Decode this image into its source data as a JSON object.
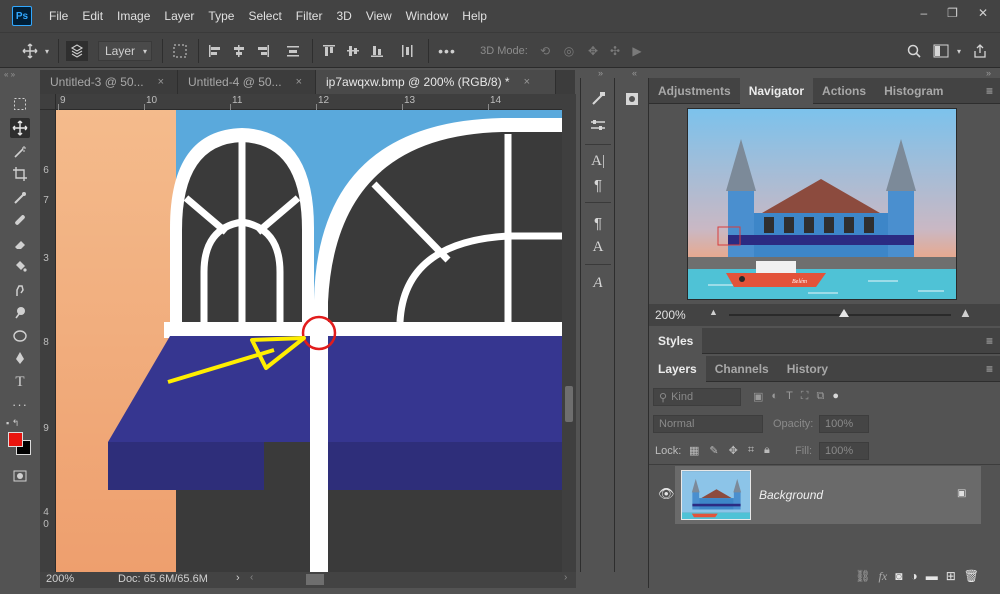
{
  "app": {
    "logo": "Ps"
  },
  "menu": [
    "File",
    "Edit",
    "Image",
    "Layer",
    "Type",
    "Select",
    "Filter",
    "3D",
    "View",
    "Window",
    "Help"
  ],
  "window_controls": {
    "minimize": "–",
    "restore": "❐",
    "close": "✕"
  },
  "options_bar": {
    "auto_select_target": "Layer",
    "mode_3d_label": "3D Mode:"
  },
  "document_tabs": [
    {
      "label": "Untitled-3 @ 50...",
      "close": "×"
    },
    {
      "label": "Untitled-4 @ 50...",
      "close": "×"
    },
    {
      "label": "ip7awqxw.bmp @ 200% (RGB/8) *",
      "close": "×",
      "active": true
    }
  ],
  "ruler": {
    "top": [
      "9",
      "10",
      "11",
      "12",
      "13",
      "14"
    ],
    "left": [
      "6",
      "7",
      "3",
      "8",
      "9",
      "4",
      "0"
    ]
  },
  "status": {
    "zoom": "200%",
    "doc": "Doc: 65.6M/65.6M",
    "arrow": "›"
  },
  "navigator_panel": {
    "tabs": [
      "Adjustments",
      "Navigator",
      "Actions",
      "Histogram"
    ],
    "active_tab": "Navigator",
    "zoom": "200%",
    "zoom_slider_level": 0.52,
    "boat_label": "Belém"
  },
  "styles_panel": {
    "title": "Styles"
  },
  "layers_panel": {
    "tabs": [
      "Layers",
      "Channels",
      "History"
    ],
    "active_tab": "Layers",
    "filter_placeholder": "Kind",
    "blend_mode": "Normal",
    "opacity_label": "Opacity:",
    "opacity_value": "100%",
    "lock_label": "Lock:",
    "fill_label": "Fill:",
    "fill_value": "100%",
    "layers": [
      {
        "name": "Background",
        "visible": true,
        "locked": true
      }
    ],
    "bottom_icons": [
      "link-icon",
      "fx-icon",
      "mask-icon",
      "adjustment-icon",
      "group-icon",
      "new-layer-icon",
      "trash-icon"
    ]
  },
  "colors": {
    "foreground": "#e8140e",
    "background": "#000000",
    "sky": "#5aa9dc",
    "awning": "#363690",
    "annotation_circle": "#e21c1c",
    "annotation_arrow": "#ffee00"
  }
}
